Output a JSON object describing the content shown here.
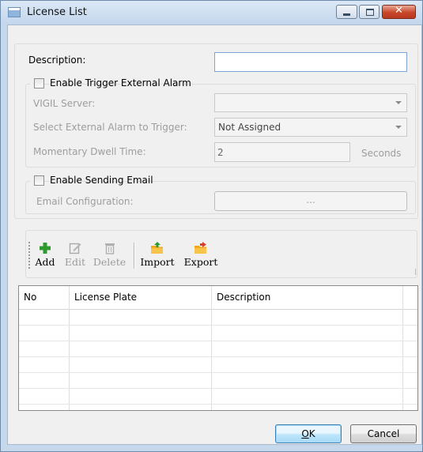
{
  "window": {
    "title": "License List",
    "icon": "window-app-icon"
  },
  "title_buttons": {
    "minimize": "minimize-icon",
    "maximize": "maximize-icon",
    "close": "close-icon",
    "close_glyph": "✕"
  },
  "form": {
    "description_label": "Description:",
    "description_value": "",
    "trigger_alarm": {
      "checkbox_label": "Enable Trigger External Alarm",
      "checked": false,
      "vigil_server_label": "VIGIL Server:",
      "vigil_server_value": "",
      "external_alarm_label": "Select External Alarm to Trigger:",
      "external_alarm_value": "Not Assigned",
      "dwell_label": "Momentary Dwell Time:",
      "dwell_value": "2",
      "dwell_unit": "Seconds"
    },
    "email": {
      "checkbox_label": "Enable Sending Email",
      "checked": false,
      "config_label": "Email Configuration:",
      "config_button": "..."
    }
  },
  "toolbar": {
    "add": "Add",
    "edit": "Edit",
    "delete": "Delete",
    "import": "Import",
    "export": "Export"
  },
  "table": {
    "columns": [
      "No",
      "License Plate",
      "Description"
    ],
    "rows": []
  },
  "buttons": {
    "ok": "OK",
    "ok_mnemonic": "O",
    "ok_rest": "K",
    "cancel": "Cancel"
  },
  "colors": {
    "title_bar": "#c6d8ec",
    "close": "#c8462a",
    "add_green": "#2e9a2e",
    "folder_orange": "#f2a81d"
  }
}
